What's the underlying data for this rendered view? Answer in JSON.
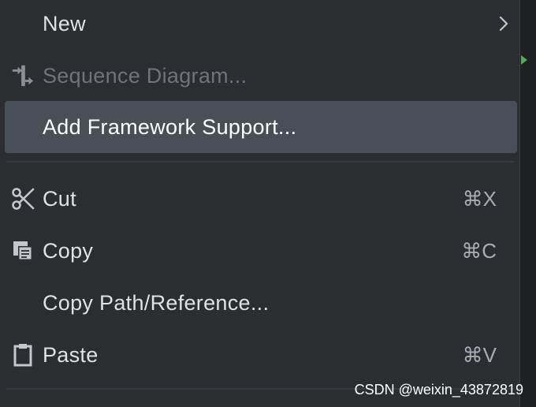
{
  "menu": {
    "items": [
      {
        "label": "New",
        "icon": "none",
        "submenu": true
      },
      {
        "label": "Sequence Diagram...",
        "icon": "sequence-diagram-icon",
        "disabled": true
      },
      {
        "label": "Add Framework Support...",
        "icon": "none",
        "selected": true
      },
      {
        "label": "Cut",
        "icon": "scissors-icon",
        "shortcut": "⌘X"
      },
      {
        "label": "Copy",
        "icon": "copy-icon",
        "shortcut": "⌘C"
      },
      {
        "label": "Copy Path/Reference...",
        "icon": "none"
      },
      {
        "label": "Paste",
        "icon": "clipboard-icon",
        "shortcut": "⌘V"
      }
    ]
  },
  "watermark": "CSDN @weixin_43872819",
  "colors": {
    "menu_bg": "#2b2d30",
    "selected_bg": "#4a4e57",
    "text": "#dfe1e5",
    "disabled_text": "#6f737a",
    "run_marker": "#4caf50"
  }
}
